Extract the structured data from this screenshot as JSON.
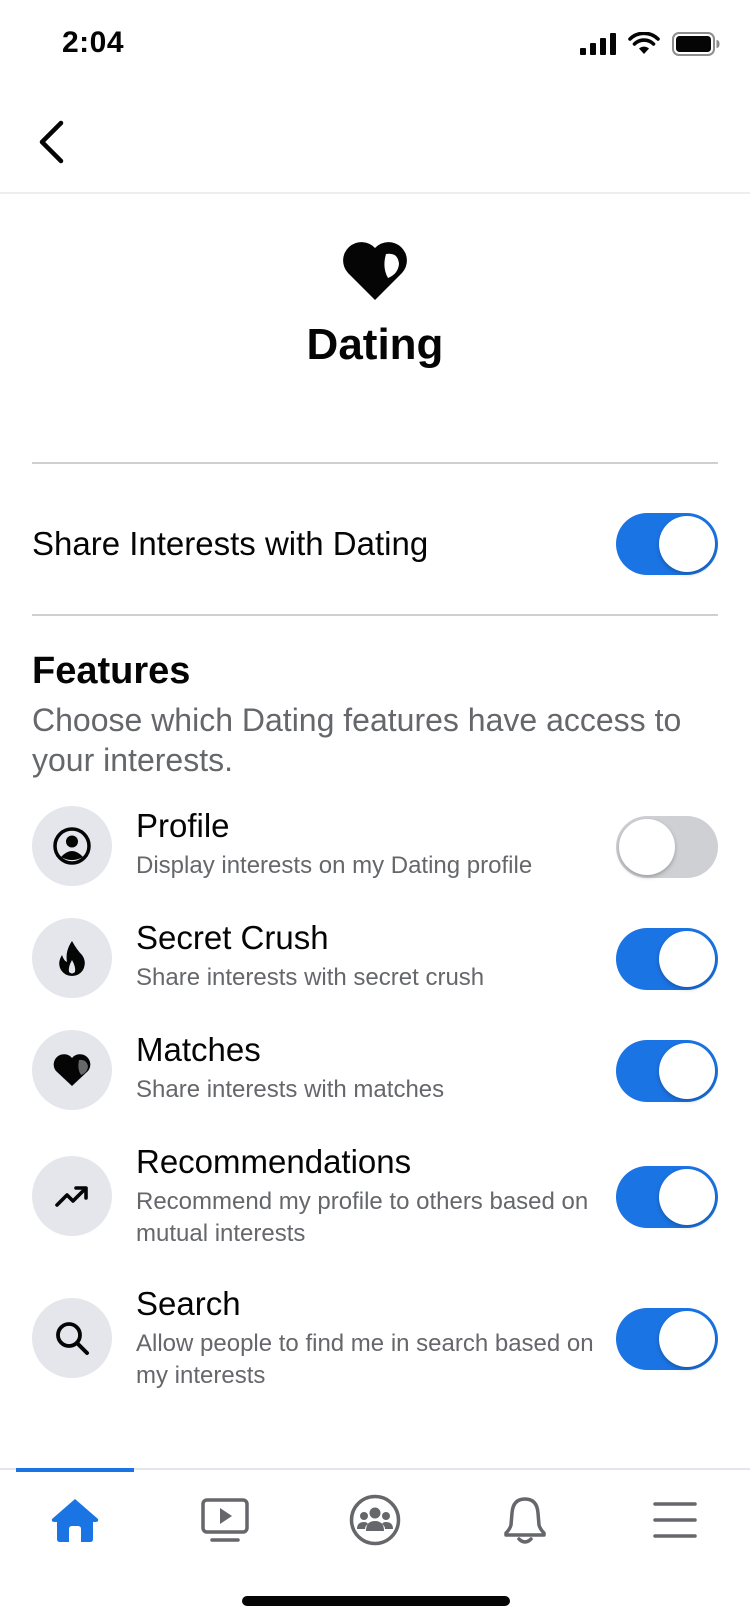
{
  "status": {
    "time": "2:04"
  },
  "header": {
    "title": "Dating",
    "icon": "dating-heart-icon"
  },
  "master_toggle": {
    "label": "Share Interests with Dating",
    "on": true
  },
  "features": {
    "title": "Features",
    "description": "Choose which Dating features have access to your interests.",
    "items": [
      {
        "icon": "profile-icon",
        "title": "Profile",
        "description": "Display interests on my Dating profile",
        "on": false
      },
      {
        "icon": "flame-icon",
        "title": "Secret Crush",
        "description": "Share interests with secret crush",
        "on": true
      },
      {
        "icon": "heart-icon",
        "title": "Matches",
        "description": "Share interests with matches",
        "on": true
      },
      {
        "icon": "trending-icon",
        "title": "Recommendations",
        "description": "Recommend my profile to others based on mutual interests",
        "on": true
      },
      {
        "icon": "search-icon",
        "title": "Search",
        "description": "Allow people to find me in search based on my interests",
        "on": true
      }
    ]
  },
  "tabs": [
    {
      "name": "home",
      "icon": "home-icon",
      "active": true
    },
    {
      "name": "watch",
      "icon": "video-icon",
      "active": false
    },
    {
      "name": "groups",
      "icon": "groups-icon",
      "active": false
    },
    {
      "name": "notifications",
      "icon": "bell-icon",
      "active": false
    },
    {
      "name": "menu",
      "icon": "menu-icon",
      "active": false
    }
  ],
  "colors": {
    "accent": "#1b74e4",
    "toggle_off": "#ced0d4",
    "secondary_text": "#65676b",
    "icon_bg": "#e4e6eb"
  }
}
